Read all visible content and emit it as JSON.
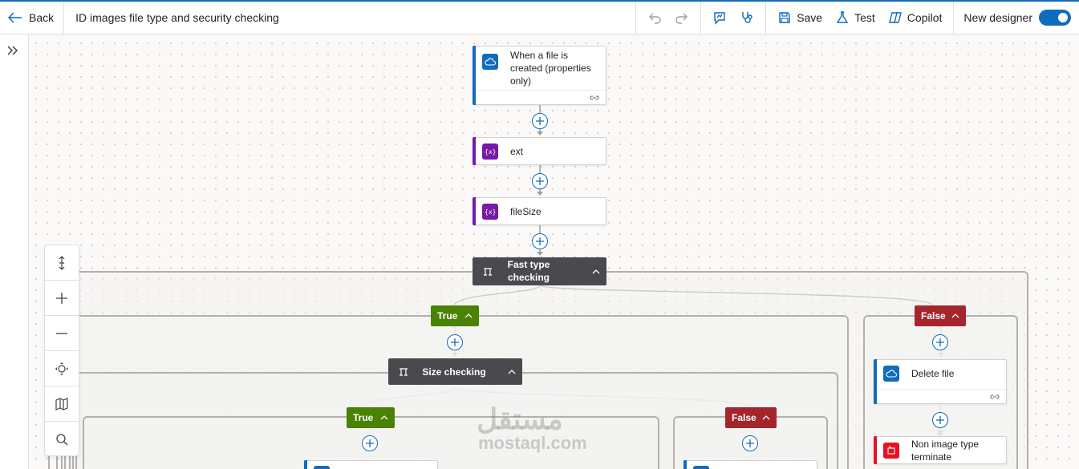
{
  "header": {
    "back_label": "Back",
    "flow_title": "ID images file type and security checking",
    "save_label": "Save",
    "test_label": "Test",
    "copilot_label": "Copilot",
    "new_designer_label": "New designer",
    "new_designer_on": true
  },
  "colors": {
    "accent": "#0f6cbd",
    "sharepoint": "#0f6cbd",
    "variable": "#7719aa",
    "control": "#484a4e",
    "true_branch": "#498205",
    "false_branch": "#a4262c",
    "terminate": "#e81123"
  },
  "flow": {
    "trigger": {
      "label": "When a file is created (properties only)",
      "icon": "sharepoint-cloud-icon"
    },
    "ext": {
      "label": "ext",
      "icon": "variable-icon"
    },
    "file_size": {
      "label": "fileSize",
      "icon": "variable-icon"
    },
    "fast_type_check": {
      "label": "Fast type checking",
      "icon": "condition-icon"
    },
    "fast_true": {
      "label": "True"
    },
    "fast_false": {
      "label": "False"
    },
    "size_check": {
      "label": "Size checking",
      "icon": "condition-icon"
    },
    "size_true": {
      "label": "True"
    },
    "size_false": {
      "label": "False"
    },
    "delete_file": {
      "label": "Delete file",
      "icon": "sharepoint-cloud-icon"
    },
    "terminate": {
      "label": "Non image type terminate",
      "icon": "terminate-icon"
    }
  },
  "zoom_controls": [
    "fit-vertical-icon",
    "zoom-in-icon",
    "zoom-out-icon",
    "fit-view-icon",
    "minimap-icon",
    "search-icon"
  ],
  "watermark": {
    "arabic": "مستقل",
    "latin": "mostaql.com"
  }
}
